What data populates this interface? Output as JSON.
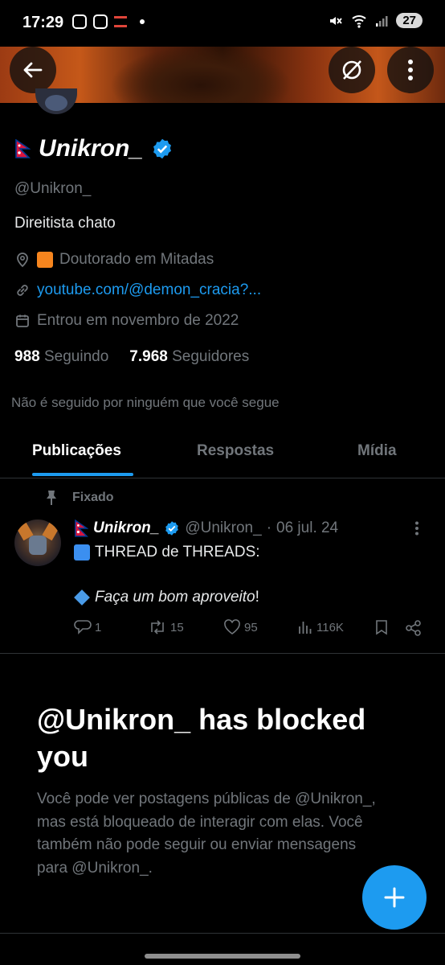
{
  "status_bar": {
    "time": "17:29",
    "battery": "27"
  },
  "profile": {
    "display_name": "Unikron_",
    "handle": "@Unikron_",
    "bio": "Direitista chato",
    "location": "Doutorado em Mitadas",
    "link": "youtube.com/@demon_cracia?...",
    "joined": "Entrou em novembro de 2022",
    "following_count": "988",
    "following_label": "Seguindo",
    "followers_count": "7.968",
    "followers_label": "Seguidores",
    "not_followed": "Não é seguido por ninguém que você segue"
  },
  "tabs": [
    {
      "label": "Publicações",
      "active": true
    },
    {
      "label": "Respostas",
      "active": false
    },
    {
      "label": "Mídia",
      "active": false
    }
  ],
  "pinned_post": {
    "pinned_label": "Fixado",
    "author_name": "Unikron_",
    "author_handle": "@Unikron_",
    "separator": "·",
    "date": "06 jul. 24",
    "line1": "THREAD de THREADS:",
    "line2_italic": "Faça um bom aproveito",
    "line2_end": "!",
    "replies": "1",
    "reposts": "15",
    "likes": "95",
    "views": "116K"
  },
  "blocked": {
    "title": "@Unikron_ has blocked you",
    "message": "Você pode ver postagens públicas de @Unikron_, mas está bloqueado de interagir com elas. Você também não pode seguir ou enviar mensagens para @Unikron_."
  },
  "colors": {
    "accent": "#1d9bf0",
    "verified": "#1d9bf0",
    "muted": "#71767b",
    "background": "#000000"
  }
}
